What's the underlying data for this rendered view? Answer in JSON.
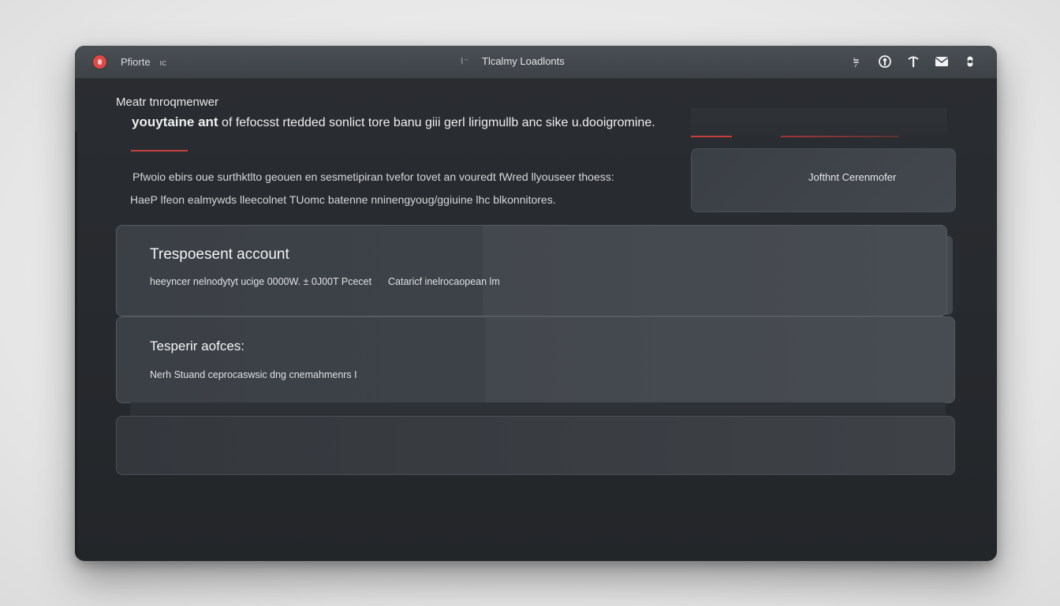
{
  "titlebar": {
    "app_name": "Pfiorte  ",
    "app_suffix": "ıc",
    "title_glyph": "⌇⁻",
    "title": "Tlcalmy Loadlonts",
    "icons": [
      "location-pin-icon",
      "account-circle-icon",
      "arrow-up-icon",
      "mail-icon",
      "notification-icon"
    ]
  },
  "main": {
    "section_label": "Meatr tnroqmenwer",
    "headline_em": "youytaine ant",
    "headline_rest": " of fefocsst rtedded sonlict tore banu giii gerl lirigmullb anc sike u.dooigromine.",
    "description_line1": "Pfwoio ebirs oue surthktlto geouen en sesmetipiran tvefor tovet an vouredt fWred llyouseer thoess:",
    "description_line2": "HaeP lfeon ealmywds lleecolnet TUomc batenne nninengyoug/ggiuine lhc blkonnitores."
  },
  "side": {
    "card_label": "Jofthnt Cerenmofer"
  },
  "panels": [
    {
      "title": "Trespoesent account",
      "text_a": "heeyncer nelnodytyt ucige  0000W.  ± 0J00T Pcecet",
      "text_b": "Cataricf inelrocaopean  lm"
    },
    {
      "title": "Tesperir aofces:",
      "text_a": "Nerh Stuand ceprocaswsic dng cnemahmenrs  I"
    }
  ],
  "colors": {
    "accent": "#e04848",
    "window_bg": "#26292d",
    "titlebar_bg": "#44494e",
    "panel_bg": "#43484e"
  }
}
